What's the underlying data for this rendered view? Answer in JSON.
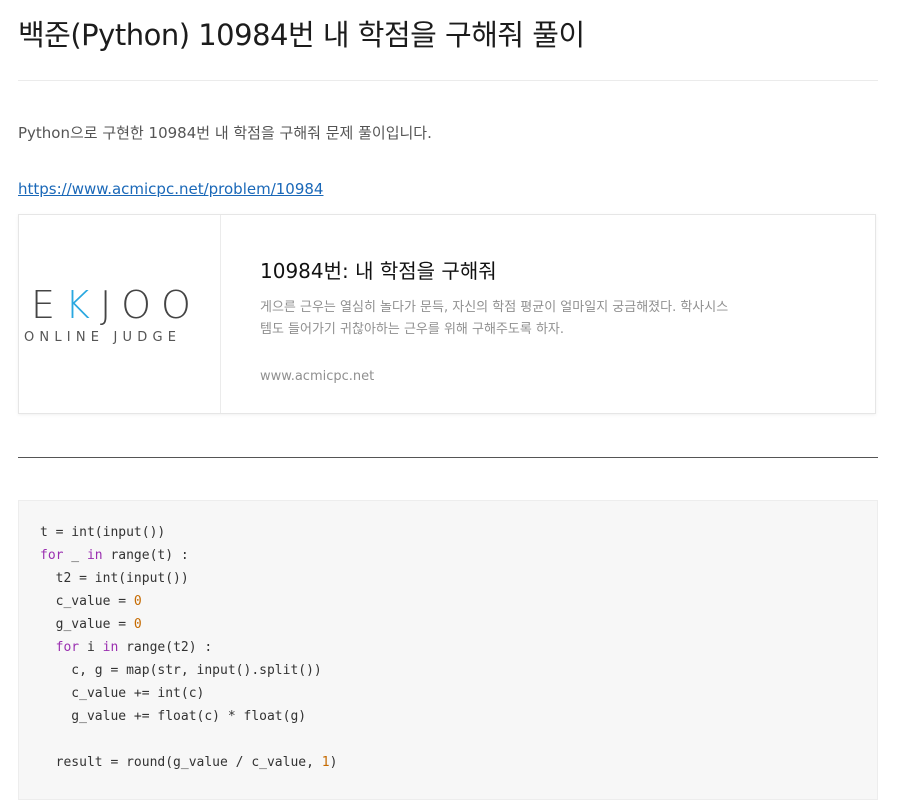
{
  "post": {
    "title": "백준(Python) 10984번 내 학점을 구해줘 풀이",
    "intro": "Python으로 구현한 10984번 내 학점을 구해줘 문제 풀이입니다.",
    "link": "https://www.acmicpc.net/problem/10984"
  },
  "card": {
    "logo_main_left": "E",
    "logo_main_k": "K",
    "logo_main_right": "JOO",
    "logo_sub": "ONLINE JUDGE",
    "title": "10984번: 내 학점을 구해줘",
    "description": "게으른 근우는 열심히 놀다가 문득, 자신의 학점 평균이 얼마일지 궁금해졌다. 학사시스템도 들어가기 귀찮아하는 근우를 위해 구해주도록 하자.",
    "domain": "www.acmicpc.net"
  },
  "code": {
    "lines": [
      [
        {
          "t": "t = int(input())",
          "c": "plain"
        }
      ],
      [
        {
          "t": "for",
          "c": "kw"
        },
        {
          "t": " _ ",
          "c": "plain"
        },
        {
          "t": "in",
          "c": "kw"
        },
        {
          "t": " range(t) :",
          "c": "plain"
        }
      ],
      [
        {
          "t": "  t2 = int(input())",
          "c": "plain"
        }
      ],
      [
        {
          "t": "  c_value = ",
          "c": "plain"
        },
        {
          "t": "0",
          "c": "num"
        }
      ],
      [
        {
          "t": "  g_value = ",
          "c": "plain"
        },
        {
          "t": "0",
          "c": "num"
        }
      ],
      [
        {
          "t": "  ",
          "c": "plain"
        },
        {
          "t": "for",
          "c": "kw"
        },
        {
          "t": " i ",
          "c": "plain"
        },
        {
          "t": "in",
          "c": "kw"
        },
        {
          "t": " range(t2) :",
          "c": "plain"
        }
      ],
      [
        {
          "t": "    c, g = map(str, input().split())",
          "c": "plain"
        }
      ],
      [
        {
          "t": "    c_value += int(c)",
          "c": "plain"
        }
      ],
      [
        {
          "t": "    g_value += float(c) * float(g)",
          "c": "plain"
        }
      ],
      [
        {
          "t": "",
          "c": "plain"
        }
      ],
      [
        {
          "t": "  result = round(g_value / c_value, ",
          "c": "plain"
        },
        {
          "t": "1",
          "c": "num"
        },
        {
          "t": ")",
          "c": "plain"
        }
      ]
    ]
  },
  "colors": {
    "link": "#1a68b8",
    "keyword": "#9a2fb0",
    "number": "#c56a00",
    "logo_accent": "#2aa8e0"
  }
}
